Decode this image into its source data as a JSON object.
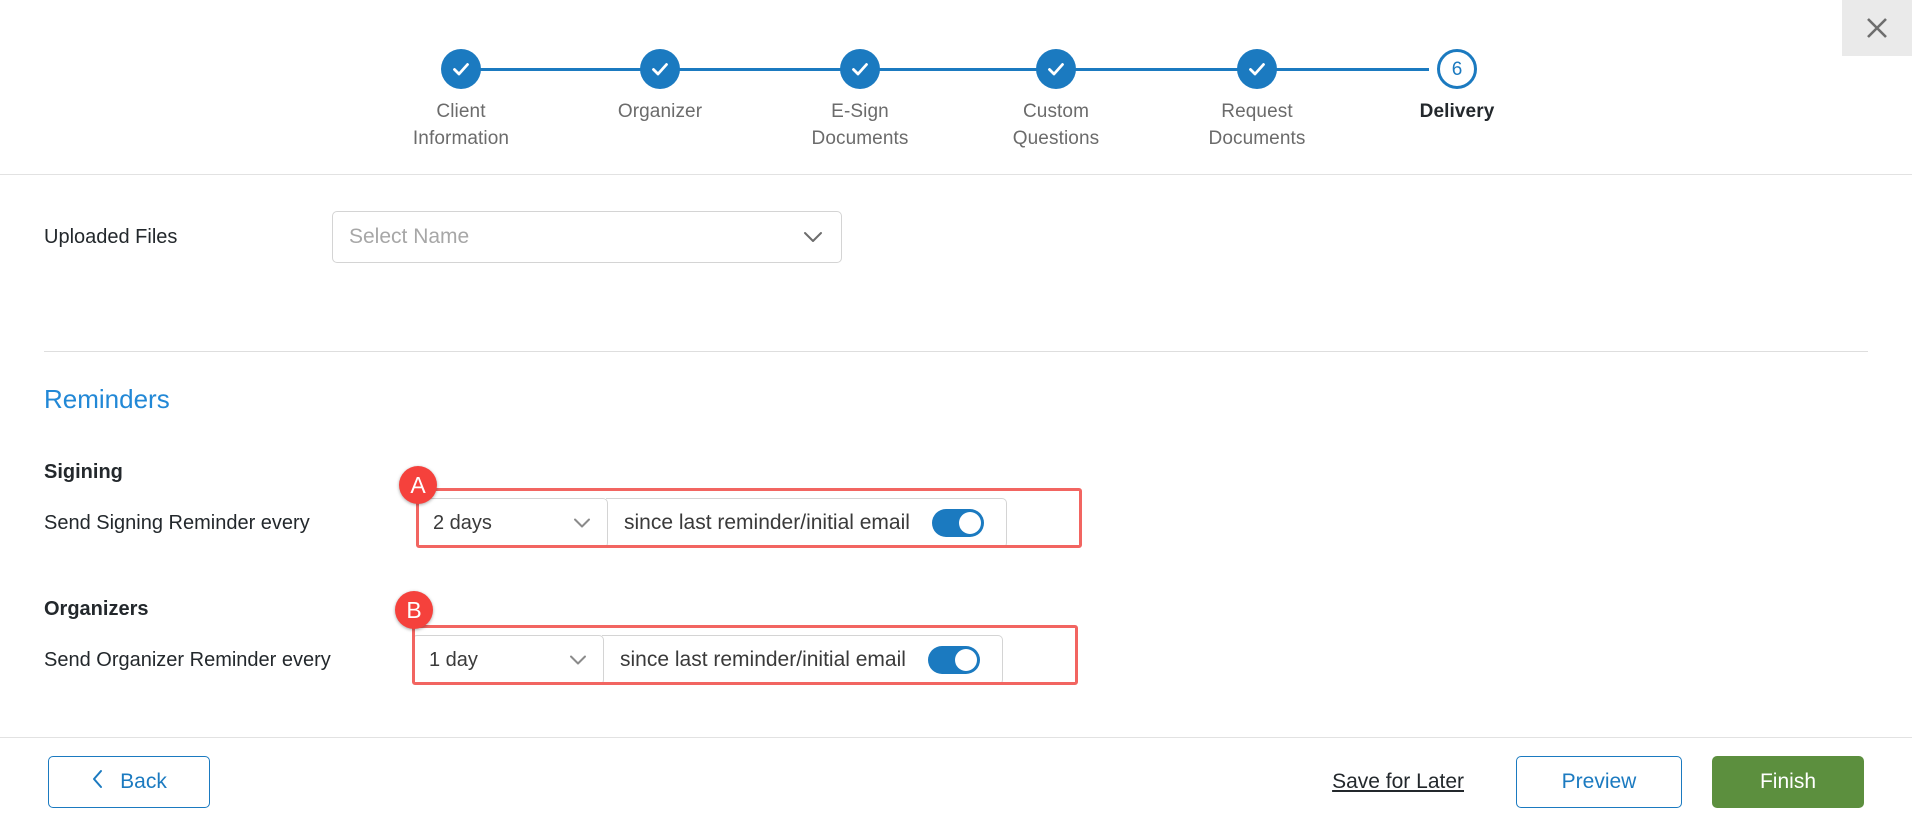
{
  "window": {
    "close_icon": "close-icon"
  },
  "stepper": {
    "steps": [
      {
        "id": 1,
        "label": "Client\nInformation",
        "state": "completed",
        "icon": "check-icon"
      },
      {
        "id": 2,
        "label": "Organizer",
        "state": "completed",
        "icon": "check-icon"
      },
      {
        "id": 3,
        "label": "E-Sign\nDocuments",
        "state": "completed",
        "icon": "check-icon"
      },
      {
        "id": 4,
        "label": "Custom\nQuestions",
        "state": "completed",
        "icon": "check-icon"
      },
      {
        "id": 5,
        "label": "Request\nDocuments",
        "state": "completed",
        "icon": "check-icon"
      },
      {
        "id": 6,
        "label": "Delivery",
        "state": "current",
        "number": "6"
      }
    ],
    "accent_color": "#1b7ac0"
  },
  "uploaded_files": {
    "label": "Uploaded Files",
    "select_placeholder": "Select Name",
    "chevron_icon": "chevron-down-icon"
  },
  "reminders": {
    "title": "Reminders",
    "signing": {
      "heading": "Sigining",
      "prefix": "Send Signing Reminder every",
      "interval_value": "2 days",
      "since_text": "since last reminder/initial email",
      "toggle_state": "on",
      "marker": "A"
    },
    "organizers": {
      "heading": "Organizers",
      "prefix": "Send Organizer Reminder every",
      "interval_value": "1 day",
      "since_text": "since last reminder/initial email",
      "toggle_state": "on",
      "marker": "B"
    }
  },
  "footer": {
    "back_label": "Back",
    "back_icon": "chevron-left-icon",
    "save_for_later_label": "Save for Later",
    "preview_label": "Preview",
    "finish_label": "Finish",
    "finish_color": "#5c8f3e"
  }
}
